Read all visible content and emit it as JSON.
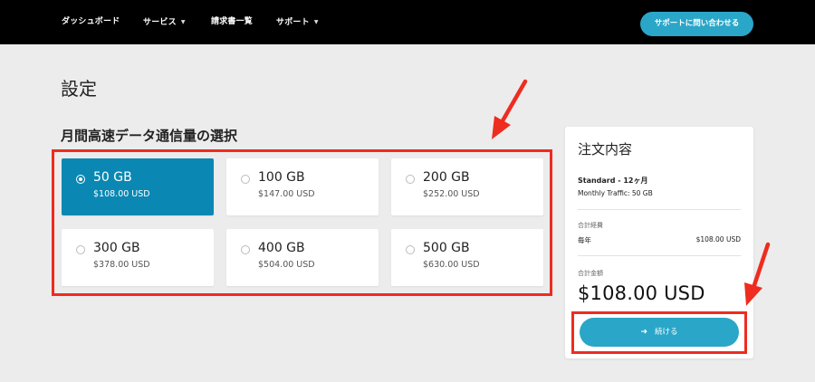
{
  "nav": {
    "items": [
      {
        "label": "ダッシュボード",
        "has_caret": false
      },
      {
        "label": "サービス",
        "has_caret": true
      },
      {
        "label": "請求書一覧",
        "has_caret": false
      },
      {
        "label": "サポート",
        "has_caret": true
      }
    ],
    "contact_button": "サポートに問い合わせる"
  },
  "page": {
    "title": "設定",
    "section_title": "月間高速データ通信量の選択"
  },
  "options": [
    {
      "gb": "50 GB",
      "price": "$108.00 USD",
      "selected": true
    },
    {
      "gb": "100 GB",
      "price": "$147.00 USD",
      "selected": false
    },
    {
      "gb": "200 GB",
      "price": "$252.00 USD",
      "selected": false
    },
    {
      "gb": "300 GB",
      "price": "$378.00 USD",
      "selected": false
    },
    {
      "gb": "400 GB",
      "price": "$504.00 USD",
      "selected": false
    },
    {
      "gb": "500 GB",
      "price": "$630.00 USD",
      "selected": false
    }
  ],
  "summary": {
    "title": "注文内容",
    "plan_name": "Standard - 12ヶ月",
    "plan_traffic": "Monthly Traffic: 50 GB",
    "subtotal_label": "合計経費",
    "period_label": "毎年",
    "period_value": "$108.00 USD",
    "total_label": "合計金額",
    "total_amount": "$108.00 USD",
    "continue_label": "続ける",
    "continue_icon": "arrow-right-icon"
  },
  "colors": {
    "accent": "#2aa6c8",
    "selected_option": "#0a88b3",
    "annotation_red": "#ee2c1f",
    "topbar": "#000000",
    "background": "#ececec"
  }
}
